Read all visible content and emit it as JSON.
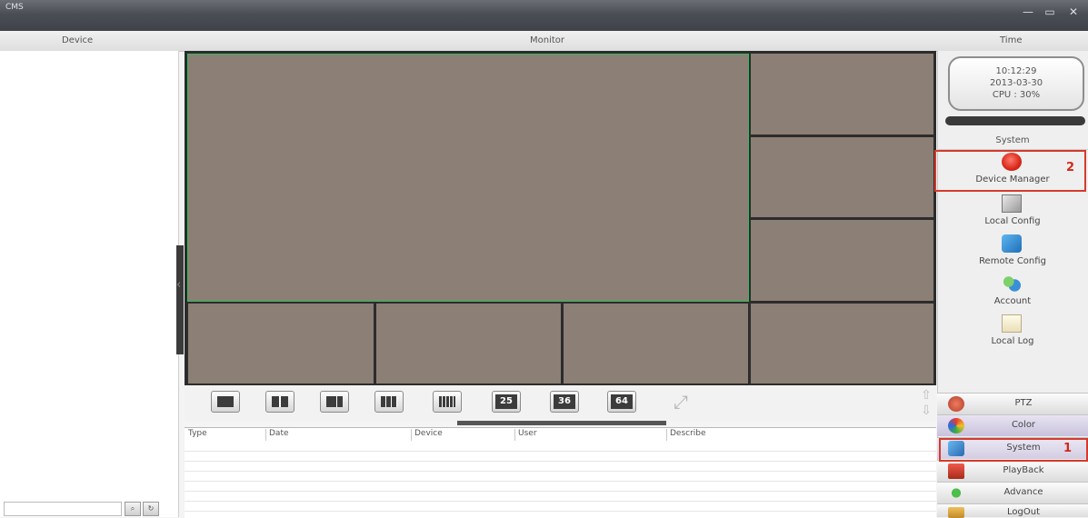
{
  "window": {
    "app_title": "CMS",
    "minimize_glyph": "—",
    "maximize_glyph": "▭",
    "close_glyph": "✕"
  },
  "header": {
    "device_label": "Device",
    "monitor_label": "Monitor",
    "time_label": "Time"
  },
  "clock": {
    "time": "10:12:29",
    "date": "2013-03-30",
    "cpu": "CPU : 30%"
  },
  "system_panel": {
    "title": "System",
    "items": [
      {
        "label": "Device Manager",
        "icon": "device-manager-icon"
      },
      {
        "label": "Local Config",
        "icon": "local-config-icon"
      },
      {
        "label": "Remote Config",
        "icon": "remote-config-icon"
      },
      {
        "label": "Account",
        "icon": "account-icon"
      },
      {
        "label": "Local Log",
        "icon": "local-log-icon"
      }
    ],
    "highlight_badge": "2"
  },
  "nav_tabs": {
    "items": [
      {
        "label": "PTZ",
        "icon": "ptz-icon"
      },
      {
        "label": "Color",
        "icon": "color-icon"
      },
      {
        "label": "System",
        "icon": "system-icon"
      },
      {
        "label": "PlayBack",
        "icon": "playback-icon"
      },
      {
        "label": "Advance",
        "icon": "advance-icon"
      },
      {
        "label": "LogOut",
        "icon": "logout-icon"
      }
    ],
    "highlight_badge": "1"
  },
  "layout_buttons": {
    "items": [
      {
        "label": "",
        "icon": "layout-1-icon"
      },
      {
        "label": "",
        "icon": "layout-4-icon"
      },
      {
        "label": "",
        "icon": "layout-6-icon"
      },
      {
        "label": "",
        "icon": "layout-9-icon"
      },
      {
        "label": "",
        "icon": "layout-16-icon"
      },
      {
        "label": "25",
        "icon": "layout-25-icon"
      },
      {
        "label": "36",
        "icon": "layout-36-icon"
      },
      {
        "label": "64",
        "icon": "layout-64-icon"
      },
      {
        "label": "",
        "icon": "fullscreen-icon"
      }
    ]
  },
  "log_table": {
    "columns": [
      "Type",
      "Date",
      "Device",
      "User",
      "Describe"
    ]
  },
  "colors": {
    "video_cell": "#8c7f75",
    "selected_cell_border": "#2ec05a",
    "highlight_box": "#d43b2c"
  }
}
